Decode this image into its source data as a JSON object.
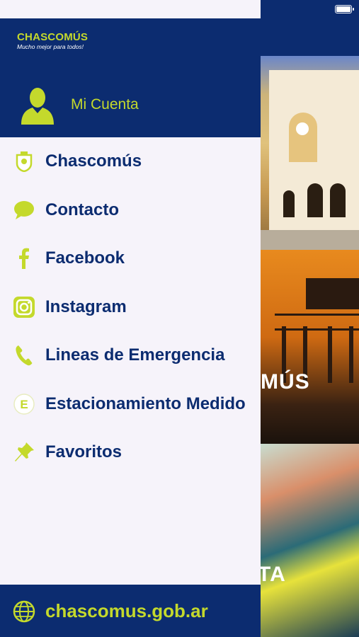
{
  "status_bar": {
    "battery_icon": "battery-icon"
  },
  "drawer": {
    "logo": {
      "title": "CHASCOMÚS",
      "subtitle": "Mucho mejor para todos!"
    },
    "account": {
      "label": "Mi Cuenta",
      "icon": "user-silhouette-icon"
    },
    "items": [
      {
        "label": "Chascomús",
        "icon": "crest-icon"
      },
      {
        "label": "Contacto",
        "icon": "chat-bubble-icon"
      },
      {
        "label": "Facebook",
        "icon": "facebook-icon"
      },
      {
        "label": "Instagram",
        "icon": "instagram-icon"
      },
      {
        "label": "Lineas de Emergencia",
        "icon": "phone-icon"
      },
      {
        "label": "Estacionamiento Medido",
        "icon": "e-circle-icon"
      },
      {
        "label": "Favoritos",
        "icon": "pin-icon"
      }
    ],
    "footer": {
      "label": "chascomus.gob.ar",
      "icon": "globe-icon"
    }
  },
  "background": {
    "cards": [
      {
        "label": ""
      },
      {
        "label": "MÚS"
      },
      {
        "label": "TA"
      }
    ]
  },
  "colors": {
    "navy": "#0c2c70",
    "lime": "#c4d92c",
    "drawer_bg": "#f6f3fa"
  }
}
